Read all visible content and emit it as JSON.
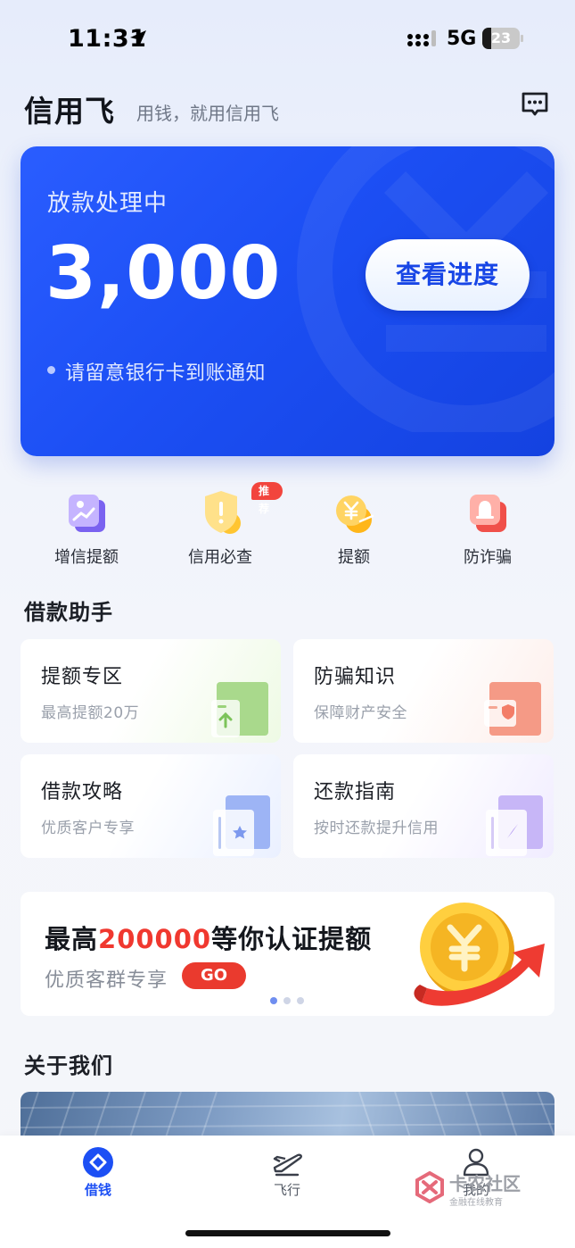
{
  "status_bar": {
    "time": "11:31",
    "network": "5G",
    "battery": "23",
    "battery_level": 0.23
  },
  "header": {
    "brand": "信用飞",
    "slogan": "用钱，就用信用飞",
    "message_icon": "chat-bubble-icon"
  },
  "loan_card": {
    "status": "放款处理中",
    "amount": "3,000",
    "button_label": "查看进度",
    "note": "请留意银行卡到账通知",
    "colors": {
      "start": "#2a5dff",
      "end": "#1442e0"
    }
  },
  "quick_actions": [
    {
      "label": "增信提额",
      "icon": "credit-chart-icon"
    },
    {
      "label": "信用必查",
      "icon": "shield-alert-icon",
      "badge": "推荐"
    },
    {
      "label": "提额",
      "icon": "yen-coin-icon"
    },
    {
      "label": "防诈骗",
      "icon": "alarm-bell-icon"
    }
  ],
  "assistant": {
    "title": "借款助手",
    "tiles": [
      {
        "title": "提额专区",
        "subtitle": "最高提额20万",
        "icon": "upload-doc-icon"
      },
      {
        "title": "防骗知识",
        "subtitle": "保障财产安全",
        "icon": "shield-doc-icon"
      },
      {
        "title": "借款攻略",
        "subtitle": "优质客户专享",
        "icon": "star-book-icon"
      },
      {
        "title": "还款指南",
        "subtitle": "按时还款提升信用",
        "icon": "compass-book-icon"
      }
    ]
  },
  "promo": {
    "title_prefix": "最高",
    "title_highlight": "200000",
    "title_suffix": "等你认证提额",
    "subtitle": "优质客群专享",
    "go_label": "GO",
    "highlight_color": "#f0382f",
    "page_count": 3,
    "current_page": 1
  },
  "about": {
    "title": "关于我们"
  },
  "tabbar": {
    "tabs": [
      {
        "label": "借钱",
        "icon": "diamond-circle-icon",
        "active": true
      },
      {
        "label": "飞行",
        "icon": "airplane-icon",
        "active": false
      },
      {
        "label": "我的",
        "icon": "user-icon",
        "active": false
      }
    ],
    "watermark_text": "卡农社区",
    "watermark_sub": "金融在线教育"
  }
}
